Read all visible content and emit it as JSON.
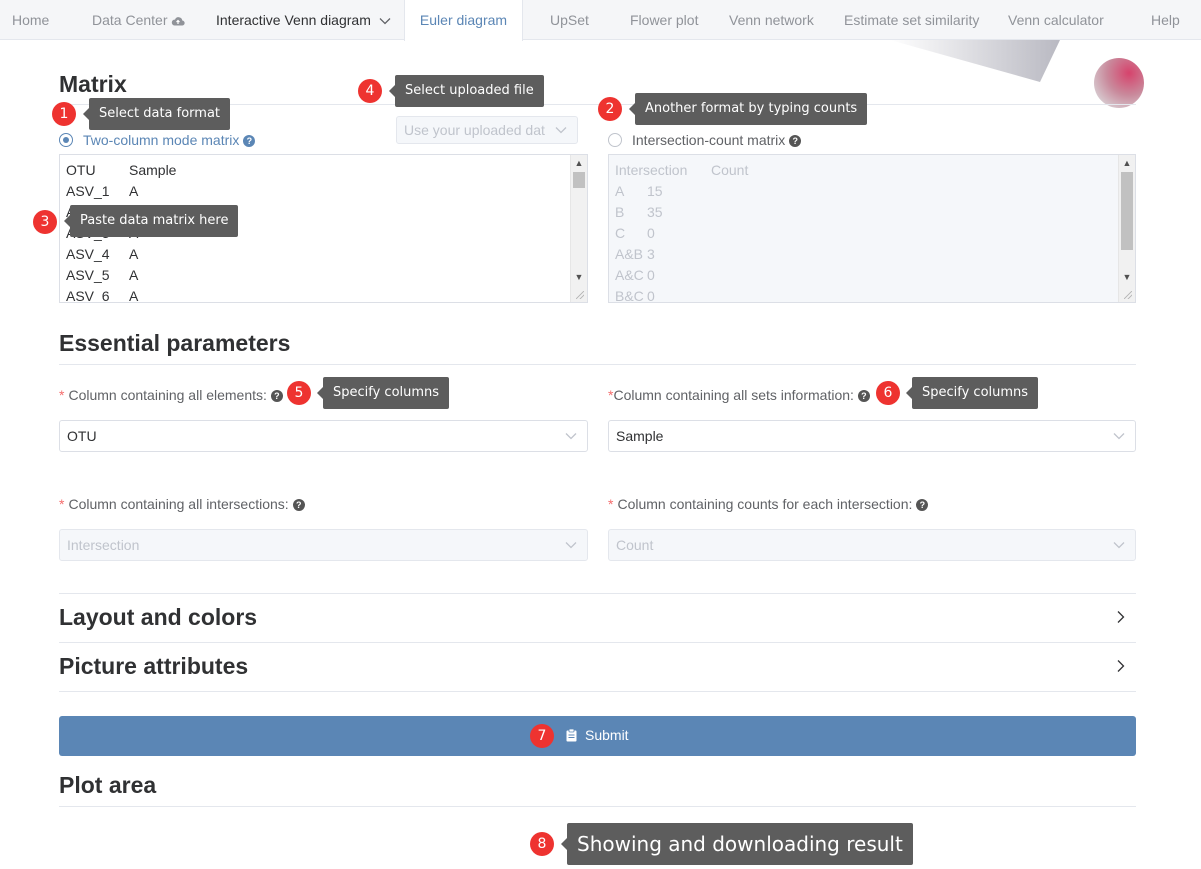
{
  "nav": {
    "home": "Home",
    "data_center": "Data Center",
    "interactive_venn": "Interactive Venn diagram",
    "euler": "Euler diagram",
    "upset": "UpSet",
    "flower": "Flower plot",
    "venn_network": "Venn network",
    "similarity": "Estimate set similarity",
    "calculator": "Venn calculator",
    "help": "Help",
    "active_color": "#5b86b5"
  },
  "matrix": {
    "title": "Matrix",
    "radio_two_column": "Two-column mode matrix",
    "radio_intersection": "Intersection-count matrix",
    "selected_mode": "Two-column mode matrix",
    "uploaded_placeholder": "Use your uploaded dat",
    "two_column_rows": [
      [
        "OTU",
        "Sample"
      ],
      [
        "ASV_1",
        "A"
      ],
      [
        "ASV_2",
        "A"
      ],
      [
        "ASV_3",
        "A"
      ],
      [
        "ASV_4",
        "A"
      ],
      [
        "ASV_5",
        "A"
      ],
      [
        "ASV_6",
        "A"
      ]
    ],
    "intersection_rows": [
      [
        "Intersection",
        "Count"
      ],
      [
        "A",
        "15"
      ],
      [
        "B",
        "35"
      ],
      [
        "C",
        "0"
      ],
      [
        "A&B",
        "3"
      ],
      [
        "A&C",
        "0"
      ],
      [
        "B&C",
        "0"
      ]
    ]
  },
  "tooltips": {
    "t1": "Select data format",
    "t2": "Another format by typing counts",
    "t3": "Paste data matrix here",
    "t4": "Select uploaded file",
    "t5": "Specify columns",
    "t6": "Specify columns",
    "t8": "Showing and downloading result"
  },
  "badges": [
    "1",
    "2",
    "3",
    "4",
    "5",
    "6",
    "7",
    "8"
  ],
  "essential": {
    "title": "Essential parameters",
    "elements_label": "Column containing all elements:",
    "elements_value": "OTU",
    "sets_label": "Column containing all sets information:",
    "sets_value": "Sample",
    "intersections_label": "Column containing all intersections:",
    "intersections_value": "Intersection",
    "counts_label": "Column containing counts for each intersection:",
    "counts_value": "Count",
    "required_mark": "*"
  },
  "sections": {
    "layout": "Layout and colors",
    "picture": "Picture attributes"
  },
  "submit": {
    "label": "Submit",
    "color": "#5b86b5"
  },
  "plot": {
    "title": "Plot area"
  },
  "colors": {
    "badge": "#ee3330",
    "tooltip": "#5d5d5d"
  },
  "icons": [
    "cloud-upload-icon",
    "chevron-down-icon",
    "help-circle-icon",
    "chevron-right-icon",
    "clipboard-icon"
  ]
}
